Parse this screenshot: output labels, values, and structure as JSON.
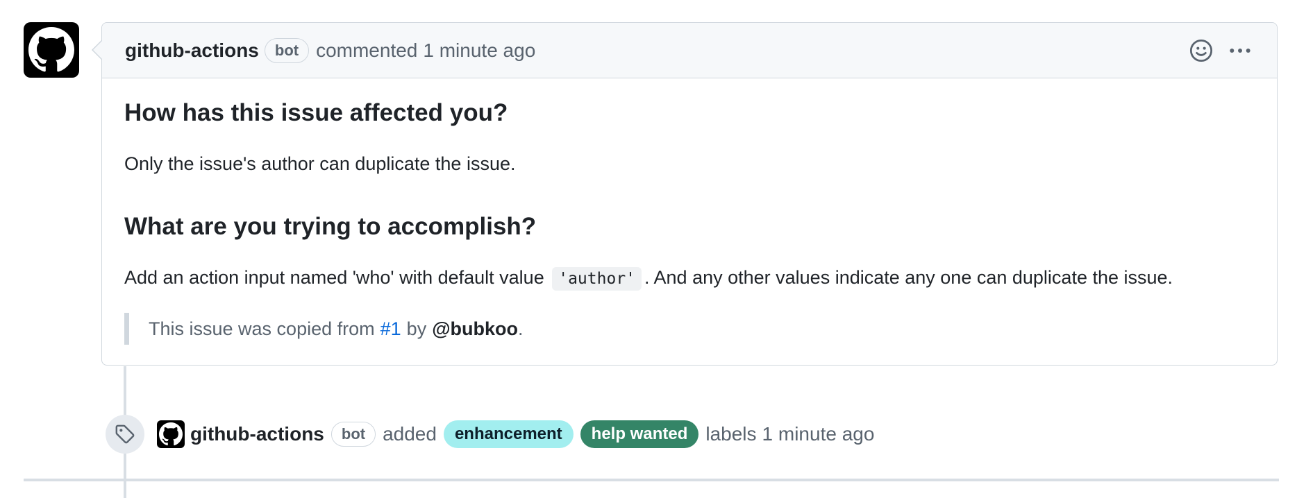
{
  "comment": {
    "author": "github-actions",
    "bot_badge": "bot",
    "action": "commented",
    "time": "1 minute ago",
    "icons": [
      "smiley-icon",
      "kebab-horizontal-icon"
    ],
    "body": {
      "heading1": "How has this issue affected you?",
      "paragraph1": "Only the issue's author can duplicate the issue.",
      "heading2": "What are you trying to accomplish?",
      "paragraph2_before": "Add an action input named 'who' with default value",
      "paragraph2_code": "'author'",
      "paragraph2_after": ". And any other values indicate any one can duplicate the issue.",
      "quote_prefix": "This issue was copied from",
      "quote_link": "#1",
      "quote_by": "by",
      "quote_mention": "@bubkoo",
      "quote_suffix": "."
    }
  },
  "event": {
    "icon": "tag-icon",
    "author": "github-actions",
    "bot_badge": "bot",
    "action": "added",
    "labels": [
      {
        "name": "enhancement",
        "color": "#a2eeef"
      },
      {
        "name": "help wanted",
        "color": "#348567"
      }
    ],
    "labels_word": "labels",
    "time": "1 minute ago"
  }
}
